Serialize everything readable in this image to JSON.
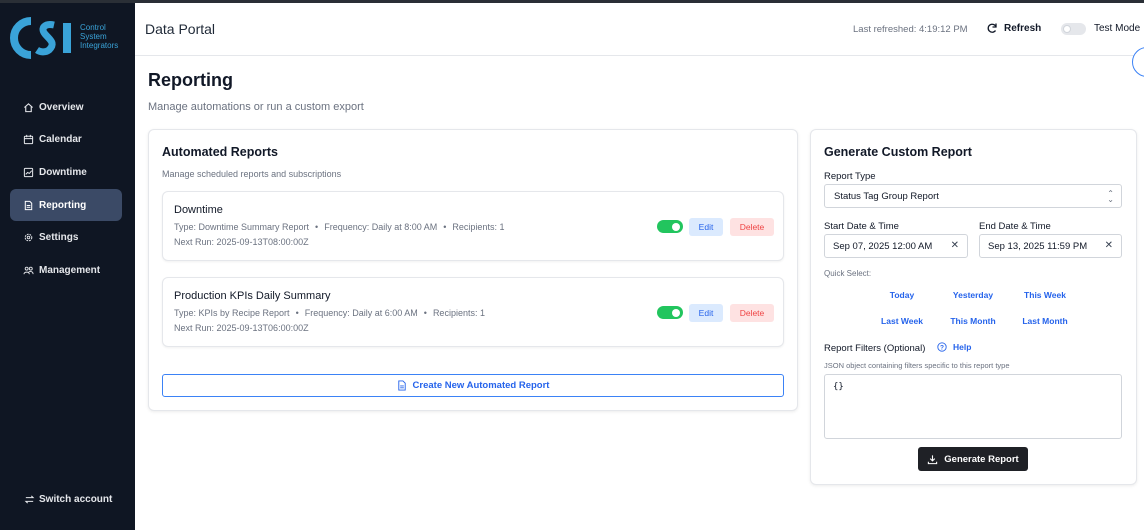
{
  "brand": {
    "logo_letters": "CSI",
    "logo_lines": [
      "Control",
      "System",
      "Integrators"
    ],
    "accent": "#3aa3d8"
  },
  "sidebar": {
    "items": [
      {
        "label": "Overview",
        "icon": "home-icon"
      },
      {
        "label": "Calendar",
        "icon": "calendar-icon"
      },
      {
        "label": "Downtime",
        "icon": "chart-icon"
      },
      {
        "label": "Reporting",
        "icon": "document-icon",
        "active": true
      },
      {
        "label": "Settings",
        "icon": "gear-icon"
      },
      {
        "label": "Management",
        "icon": "users-icon"
      }
    ],
    "switch_account": "Switch account"
  },
  "header": {
    "title": "Data Portal",
    "last_refreshed": "Last refreshed: 4:19:12 PM",
    "refresh_label": "Refresh",
    "test_mode_label": "Test Mode",
    "test_mode_on": false
  },
  "page": {
    "title": "Reporting",
    "subtitle": "Manage automations or run a custom export"
  },
  "automated": {
    "title": "Automated Reports",
    "subtitle": "Manage scheduled reports and subscriptions",
    "reports": [
      {
        "name": "Downtime",
        "type": "Type: Downtime Summary Report",
        "frequency": "Frequency: Daily at 8:00 AM",
        "recipients": "Recipients: 1",
        "next_run": "Next Run: 2025-09-13T08:00:00Z",
        "enabled": true,
        "edit_label": "Edit",
        "delete_label": "Delete"
      },
      {
        "name": "Production KPIs Daily Summary",
        "type": "Type: KPIs by Recipe Report",
        "frequency": "Frequency: Daily at 6:00 AM",
        "recipients": "Recipients: 1",
        "next_run": "Next Run: 2025-09-13T06:00:00Z",
        "enabled": true,
        "edit_label": "Edit",
        "delete_label": "Delete"
      }
    ],
    "create_label": "Create New Automated Report"
  },
  "custom": {
    "title": "Generate Custom Report",
    "report_type_label": "Report Type",
    "report_type_value": "Status Tag Group Report",
    "start_label": "Start Date & Time",
    "start_value": "Sep 07, 2025 12:00 AM",
    "end_label": "End Date & Time",
    "end_value": "Sep 13, 2025 11:59 PM",
    "quick_select_label": "Quick Select:",
    "quick_select": [
      "Today",
      "Yesterday",
      "This Week",
      "Last Week",
      "This Month",
      "Last Month"
    ],
    "filters_label": "Report Filters (Optional)",
    "help_label": "Help",
    "filters_desc": "JSON object containing filters specific to this report type",
    "filters_value": "{}",
    "generate_label": "Generate Report"
  },
  "colors": {
    "sidebar_bg": "#0f1623",
    "sidebar_active": "#3b4a66",
    "primary": "#2563eb",
    "toggle_on": "#22c55e",
    "danger": "#ef4444"
  }
}
